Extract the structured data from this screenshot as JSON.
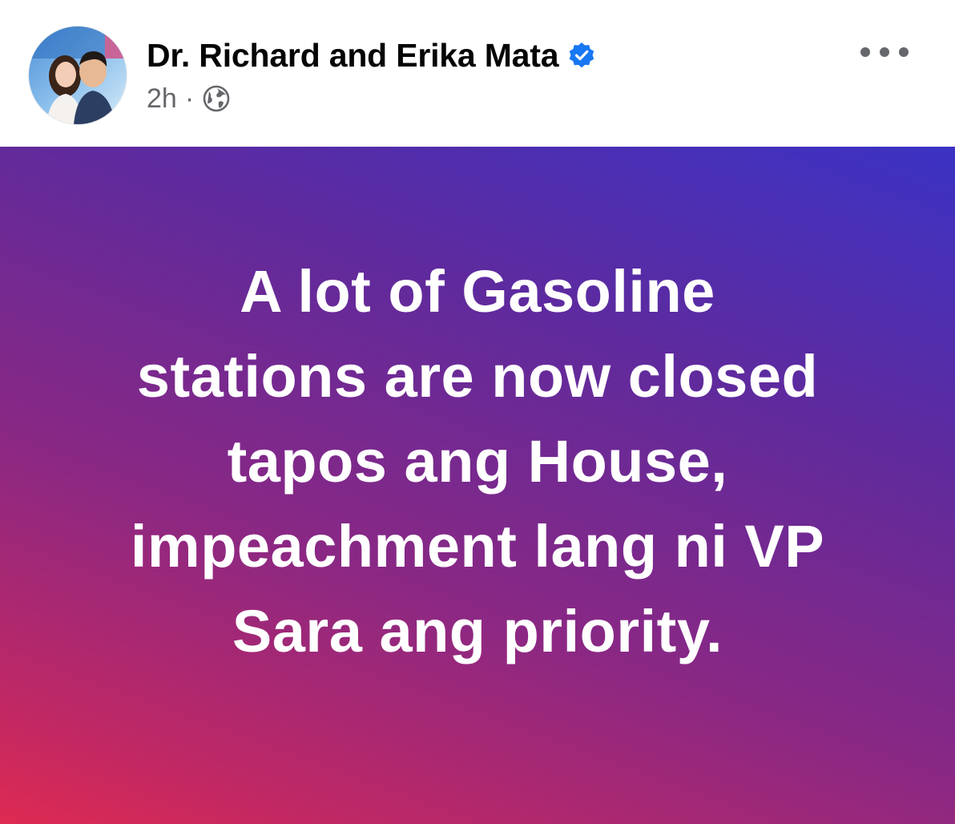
{
  "post": {
    "author": "Dr. Richard and Erika Mata",
    "timestamp": "2h",
    "separator": "·",
    "text_lines": [
      "A lot of Gasoline",
      "stations are now closed",
      "tapos ang House,",
      "impeachment lang ni VP",
      "Sara ang priority."
    ]
  },
  "icons": {
    "verified": "verified-badge-icon",
    "audience": "globe-icon",
    "more": "more-options-icon"
  },
  "colors": {
    "verified_blue": "#1877f2",
    "meta_gray": "#65676b",
    "gradient_top_right": "#3b32c4",
    "gradient_bottom_left": "#de2a52"
  }
}
